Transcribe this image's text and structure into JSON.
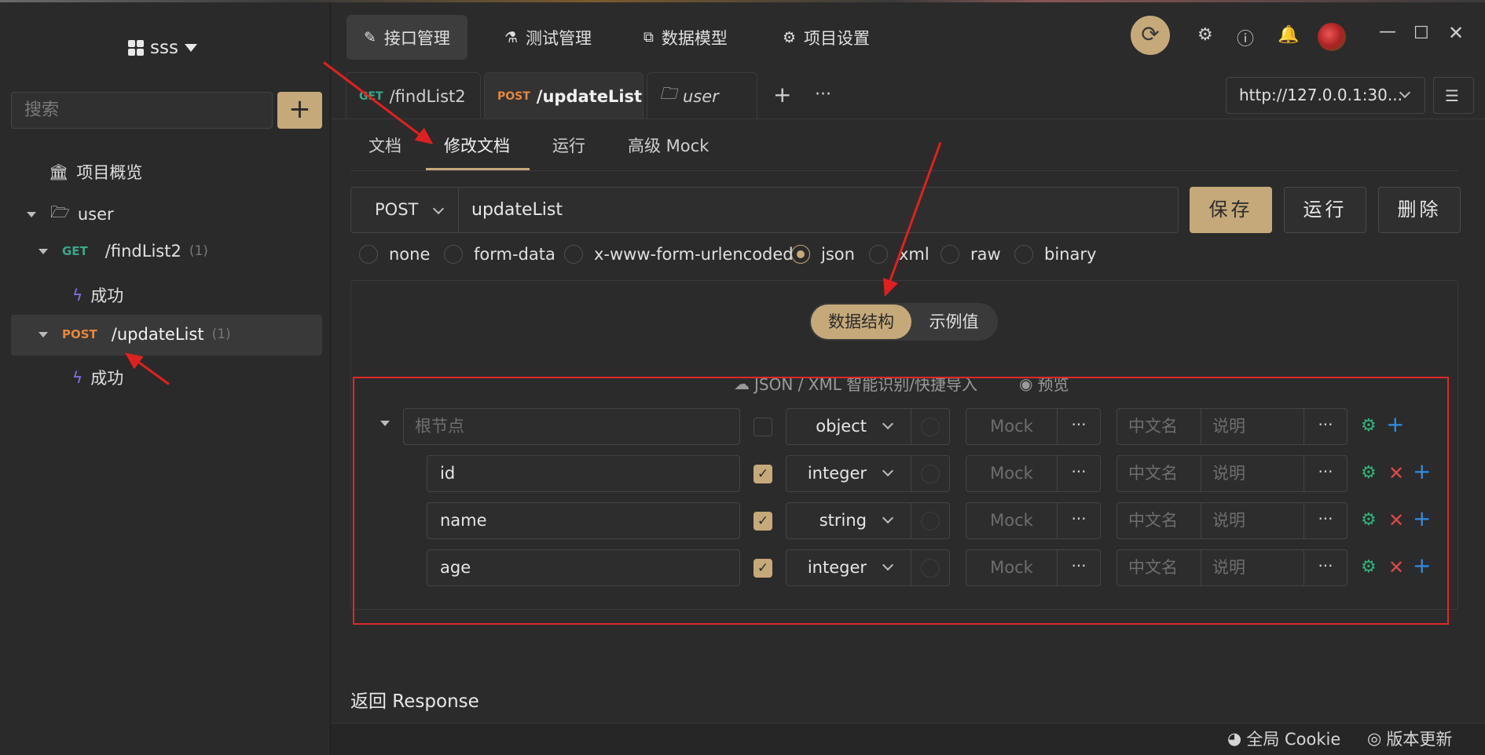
{
  "sidebar": {
    "project_name": "sss",
    "search_placeholder": "搜索",
    "add_label": "+",
    "overview": "项目概览",
    "folder": "user",
    "items": [
      {
        "method": "GET",
        "path": "/findList2",
        "count": "(1)",
        "child": "成功"
      },
      {
        "method": "POST",
        "path": "/updateList",
        "count": "(1)",
        "child": "成功"
      }
    ]
  },
  "topnav": {
    "tabs": [
      "接口管理",
      "测试管理",
      "数据模型",
      "项目设置"
    ]
  },
  "filetabs": {
    "tab1_method": "GET",
    "tab1_path": "/findList2",
    "tab2_method": "POST",
    "tab2_path": "/updateList",
    "tab3_label": "user",
    "add": "+",
    "more": "···"
  },
  "env": {
    "url": "http://127.0.0.1:30..."
  },
  "subtabs": [
    "文档",
    "修改文档",
    "运行",
    "高级 Mock"
  ],
  "request": {
    "method": "POST",
    "path": "updateList",
    "save": "保存",
    "run": "运行",
    "delete": "删除"
  },
  "body_types": [
    "none",
    "form-data",
    "x-www-form-urlencoded",
    "json",
    "xml",
    "raw",
    "binary"
  ],
  "body_type_selected": "json",
  "schema": {
    "seg_on": "数据结构",
    "seg_off": "示例值",
    "import_label": "JSON / XML 智能识别/快捷导入",
    "preview_label": "预览",
    "root_placeholder": "根节点",
    "mock_placeholder": "Mock",
    "cn_placeholder": "中文名",
    "desc_placeholder": "说明",
    "dots": "···",
    "root_type": "object",
    "fields": [
      {
        "name": "id",
        "type": "integer"
      },
      {
        "name": "name",
        "type": "string"
      },
      {
        "name": "age",
        "type": "integer"
      }
    ]
  },
  "response_title": "返回 Response",
  "bottom": {
    "cookie": "全局 Cookie",
    "update": "版本更新"
  },
  "colors": {
    "accent": "#c6a97a",
    "get": "#3aa88a",
    "post": "#e8873a",
    "annotation": "#e02828"
  }
}
